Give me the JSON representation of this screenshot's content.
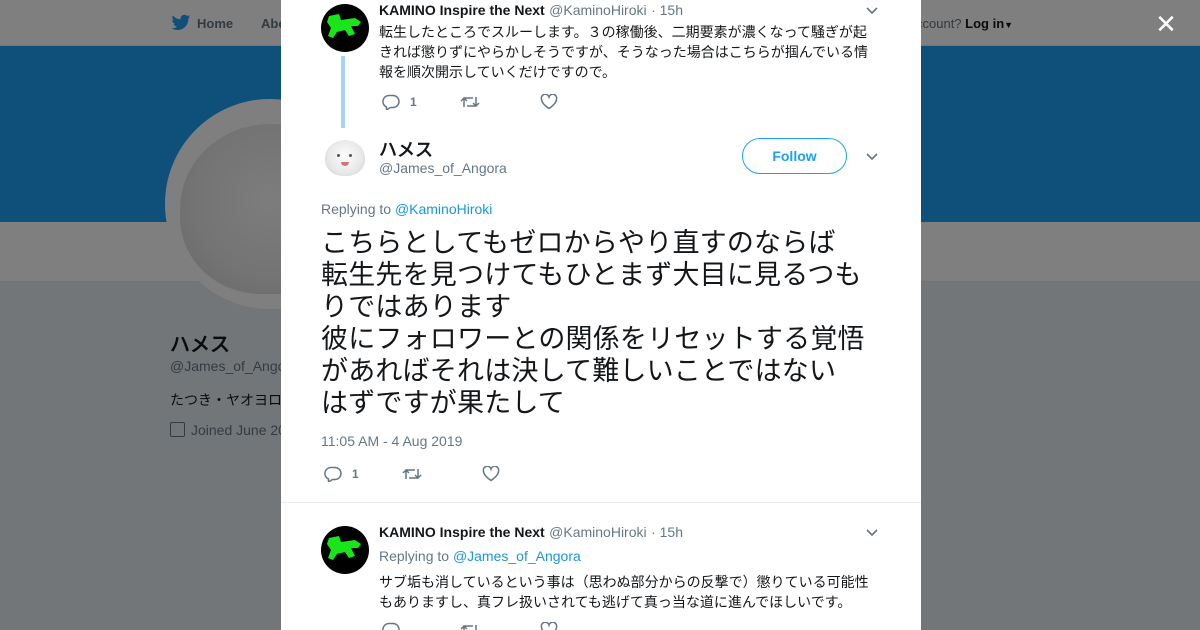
{
  "background": {
    "nav": {
      "home": "Home",
      "about": "Abo",
      "account_prompt": "ccount?",
      "login": "Log in"
    },
    "profile": {
      "name": "ハメス",
      "handle": "@James_of_Ango",
      "bio": "たつき・ヤオヨロ",
      "joined": "Joined June 20"
    }
  },
  "modal": {
    "close_icon": "close-icon",
    "parent_tweet": {
      "name": "KAMINO Inspire the Next",
      "handle": "@KaminoHiroki",
      "time": "· 15h",
      "text": "転生したところでスルーします。３の稼働後、二期要素が濃くなって騒ぎが起きれば懲りずにやらかしそうですが、そうなった場合はこちらが掴んでいる情報を順次開示していくだけですので。",
      "reply_count": "1"
    },
    "main_tweet": {
      "name": "ハメス",
      "handle": "@James_of_Angora",
      "follow_label": "Follow",
      "replying_prefix": "Replying to",
      "replying_to": "@KaminoHiroki",
      "text_lines": [
        "こちらとしてもゼロからやり直すのならば",
        "転生先を見つけてもひとまず大目に見るつも",
        "りではあります",
        "彼にフォロワーとの関係をリセットする覚悟",
        "があればそれは決して難しいことではない",
        "はずですが果たして"
      ],
      "timestamp": "11:05 AM - 4 Aug 2019",
      "reply_count": "1"
    },
    "reply_tweet": {
      "name": "KAMINO Inspire the Next",
      "handle": "@KaminoHiroki",
      "time": "· 15h",
      "replying_prefix": "Replying to",
      "replying_to": "@James_of_Angora",
      "text": "サブ垢も消しているという事は（思わぬ部分からの反撃で）懲りている可能性もありますし、真フレ扱いされても逃げて真っ当な道に進んでほしいです。"
    }
  },
  "colors": {
    "brand_blue": "#1da1f2",
    "link_blue": "#1b95e0",
    "frog_green": "#19e619"
  }
}
